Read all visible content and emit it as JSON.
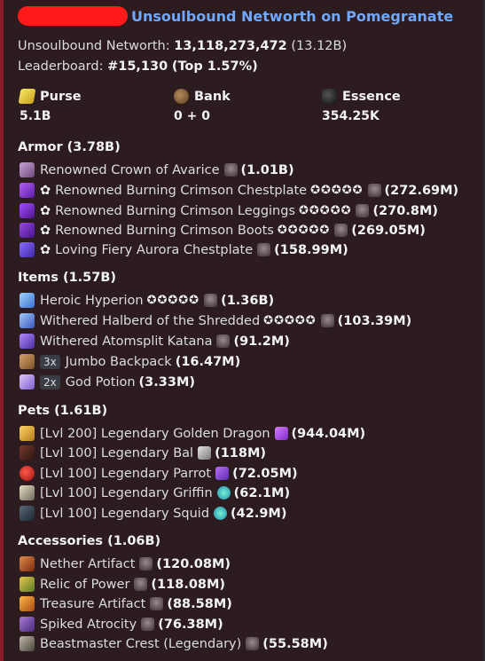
{
  "header": {
    "title": "Unsoulbound Networth on Pomegranate"
  },
  "summary": {
    "networth_label": "Unsoulbound Networth:",
    "networth_value": "13,118,273,472",
    "networth_short": "(13.12B)",
    "leaderboard_label": "Leaderboard:",
    "leaderboard_rank": "#15,130",
    "leaderboard_pct": "(Top 1.57%)"
  },
  "stats": [
    {
      "label": "Purse",
      "value": "5.1B",
      "icon": "gold-ingot-icon"
    },
    {
      "label": "Bank",
      "value": "0 + 0",
      "icon": "bank-icon"
    },
    {
      "label": "Essence",
      "value": "354.25K",
      "icon": "essence-icon"
    }
  ],
  "sections": {
    "armor": {
      "title": "Armor (3.78B)",
      "items": [
        {
          "name": "Renowned Crown of Avarice",
          "stars": "",
          "value": "(1.01B)",
          "flower": false
        },
        {
          "name": "Renowned Burning Crimson Chestplate",
          "stars": "✪✪✪✪✪",
          "value": "(272.69M)",
          "flower": true
        },
        {
          "name": "Renowned Burning Crimson Leggings",
          "stars": "✪✪✪✪✪",
          "value": "(270.8M)",
          "flower": true
        },
        {
          "name": "Renowned Burning Crimson Boots",
          "stars": "✪✪✪✪✪",
          "value": "(269.05M)",
          "flower": true
        },
        {
          "name": "Loving Fiery Aurora Chestplate",
          "stars": "",
          "value": "(158.99M)",
          "flower": true
        }
      ]
    },
    "items": {
      "title": "Items (1.57B)",
      "items": [
        {
          "name": "Heroic Hyperion",
          "count": "",
          "stars": "✪✪✪✪✪",
          "value": "(1.36B)"
        },
        {
          "name": "Withered Halberd of the Shredded",
          "count": "",
          "stars": "✪✪✪✪✪",
          "value": "(103.39M)"
        },
        {
          "name": "Withered Atomsplit Katana",
          "count": "",
          "stars": "",
          "value": "(91.2M)"
        },
        {
          "name": "Jumbo Backpack",
          "count": "3x",
          "stars": "",
          "value": "(16.47M)"
        },
        {
          "name": "God Potion",
          "count": "2x",
          "stars": "",
          "value": "(3.33M)"
        }
      ]
    },
    "pets": {
      "title": "Pets (1.61B)",
      "items": [
        {
          "name": "[Lvl 200] Legendary Golden Dragon",
          "value": "(944.04M)"
        },
        {
          "name": "[Lvl 100] Legendary Bal",
          "value": "(118M)"
        },
        {
          "name": "[Lvl 100] Legendary Parrot",
          "value": "(72.05M)"
        },
        {
          "name": "[Lvl 100] Legendary Griffin",
          "value": "(62.1M)"
        },
        {
          "name": "[Lvl 100] Legendary Squid",
          "value": "(42.9M)"
        }
      ]
    },
    "accessories": {
      "title": "Accessories (1.06B)",
      "items": [
        {
          "name": "Nether Artifact",
          "value": "(120.08M)"
        },
        {
          "name": "Relic of Power",
          "value": "(118.08M)"
        },
        {
          "name": "Treasure Artifact",
          "value": "(88.58M)"
        },
        {
          "name": "Spiked Atrocity",
          "value": "(76.38M)"
        },
        {
          "name": "Beastmaster Crest (Legendary)",
          "value": "(55.58M)"
        }
      ]
    }
  },
  "colors": {
    "embed_border": "#8e1a2a",
    "embed_bg": "#2c1b1f",
    "title_link": "#6fa8ff",
    "redaction": "#ff1a1a"
  }
}
